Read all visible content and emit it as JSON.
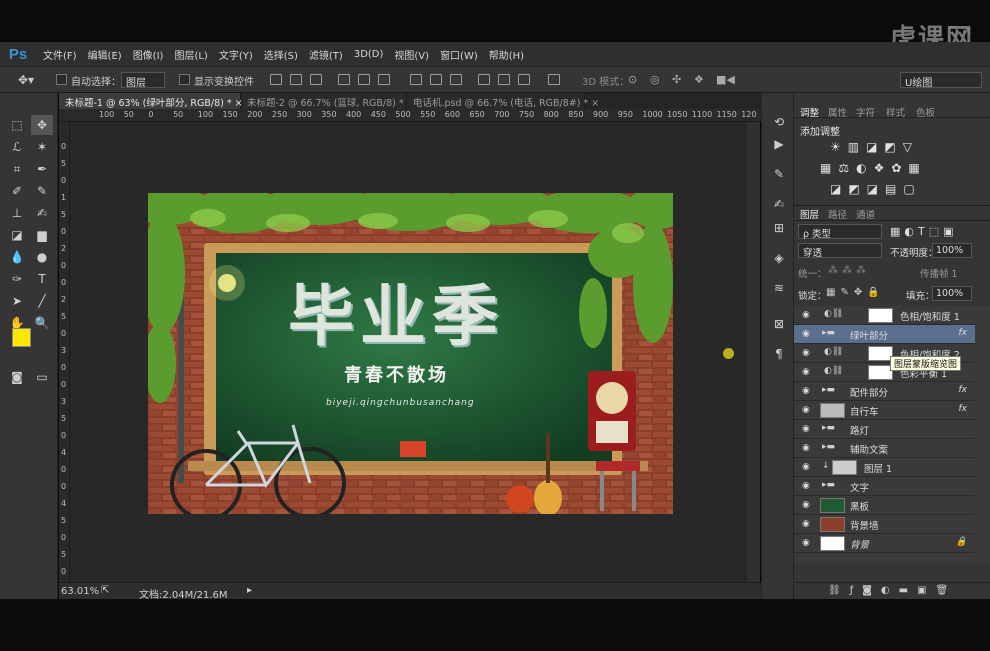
{
  "watermark": "虎课网",
  "app": {
    "logo": "Ps"
  },
  "menu": [
    "文件(F)",
    "编辑(E)",
    "图像(I)",
    "图层(L)",
    "文字(Y)",
    "选择(S)",
    "滤镜(T)",
    "3D(D)",
    "视图(V)",
    "窗口(W)",
    "帮助(H)"
  ],
  "options": {
    "auto_select": "自动选择：",
    "auto_select_value": "图层",
    "show_transform": "显示变换控件",
    "mode_3d": "3D 模式：",
    "workspace": "U绘图"
  },
  "tabs": [
    {
      "label": "未标题-1 @ 63% (绿叶部分, RGB/8) *",
      "close": "×"
    },
    {
      "label": "未标题-2 @ 66.7% (篮球, RGB/8) *",
      "close": "×"
    },
    {
      "label": "电话机.psd @ 66.7% (电话, RGB/8#) *",
      "close": "×"
    }
  ],
  "ruler_h": [
    "100",
    "50",
    "0",
    "50",
    "100",
    "150",
    "200",
    "250",
    "300",
    "350",
    "400",
    "450",
    "500",
    "550",
    "600",
    "650",
    "700",
    "750",
    "800",
    "850",
    "900",
    "950",
    "1000",
    "1050",
    "1100",
    "1150",
    "120"
  ],
  "ruler_v": [
    "0",
    "5",
    "0",
    "1",
    "5",
    "0",
    "2",
    "0",
    "0",
    "2",
    "5",
    "0",
    "3",
    "0",
    "0",
    "3",
    "5",
    "0",
    "4",
    "0",
    "0",
    "4",
    "5",
    "0",
    "5",
    "0"
  ],
  "canvas": {
    "title": "毕业季",
    "subtitle": "青春不散场",
    "pinyin": "biyeji.qingchunbusanchang",
    "colors": {
      "board": "#1f5a33",
      "brick": "#8a3f2b",
      "frame": "#c99a59",
      "leaf": "#5a9c2e"
    }
  },
  "status": {
    "zoom": "63.01%",
    "doc": "文档:2.04M/21.6M"
  },
  "adjust": {
    "tabs": [
      "调整",
      "属性",
      "字符",
      "样式",
      "色板"
    ],
    "title": "添加调整"
  },
  "layers_panel": {
    "tabs": [
      "图层",
      "路径",
      "通道"
    ],
    "kind": "ρ 类型",
    "blend": "穿透",
    "opacity_label": "不透明度：",
    "opacity": "100%",
    "unify": "统一：",
    "propagate": "传播帧 1",
    "lock_label": "锁定：",
    "fill_label": "填充：",
    "fill": "100%",
    "tooltip": "图层蒙版缩览图",
    "layers": [
      {
        "name": "色相/饱和度 1",
        "kind": "adjust",
        "fx": ""
      },
      {
        "name": "绿叶部分",
        "kind": "group",
        "fx": "fx",
        "selected": true
      },
      {
        "name": "色相/饱和度 2",
        "kind": "adjust",
        "fx": ""
      },
      {
        "name": "色彩平衡 1",
        "kind": "adjust",
        "fx": ""
      },
      {
        "name": "配件部分",
        "kind": "group",
        "fx": "fx"
      },
      {
        "name": "自行车",
        "kind": "layer",
        "fx": "fx"
      },
      {
        "name": "路灯",
        "kind": "group",
        "fx": ""
      },
      {
        "name": "辅助文案",
        "kind": "group",
        "fx": ""
      },
      {
        "name": "图层 1",
        "kind": "layer",
        "fx": ""
      },
      {
        "name": "文字",
        "kind": "group",
        "fx": ""
      },
      {
        "name": "黑板",
        "kind": "layer",
        "fx": ""
      },
      {
        "name": "背景墙",
        "kind": "layer",
        "fx": ""
      },
      {
        "name": "背景",
        "kind": "bg",
        "fx": ""
      }
    ]
  }
}
